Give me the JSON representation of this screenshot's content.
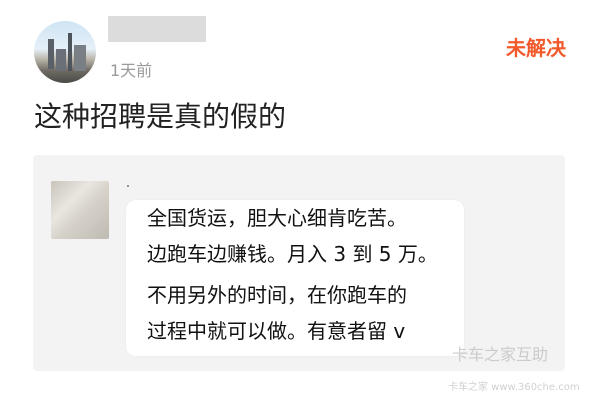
{
  "post": {
    "timestamp": "1天前",
    "status": "未解决",
    "title": "这种招聘是真的假的"
  },
  "quoted_message": {
    "lines": [
      "全国货运，胆大心细肯吃苦。",
      "边跑车边赚钱。月入 3 到 5 万。",
      "不用另外的时间，在你跑车的",
      "过程中就可以做。有意者留 v"
    ]
  },
  "watermark": {
    "brand": "卡车之家互助",
    "url": "卡车之家 www.360che.com"
  },
  "colors": {
    "status": "#f25a2c",
    "card_background": "#f3f3f3",
    "timestamp": "#9a9a9a"
  }
}
